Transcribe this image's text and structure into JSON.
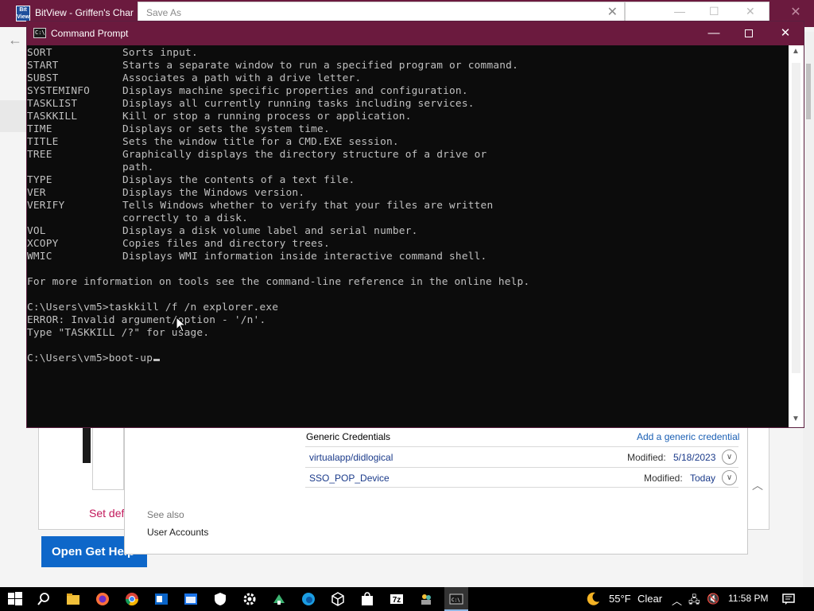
{
  "browser": {
    "title": "BitView - Griffen's Char",
    "app_icon_text": "Bit View"
  },
  "save_as": {
    "title": "Save As"
  },
  "cmd": {
    "title": "Command Prompt",
    "help_rows": [
      {
        "cmd": "SORT",
        "desc": "Sorts input."
      },
      {
        "cmd": "START",
        "desc": "Starts a separate window to run a specified program or command."
      },
      {
        "cmd": "SUBST",
        "desc": "Associates a path with a drive letter."
      },
      {
        "cmd": "SYSTEMINFO",
        "desc": "Displays machine specific properties and configuration."
      },
      {
        "cmd": "TASKLIST",
        "desc": "Displays all currently running tasks including services."
      },
      {
        "cmd": "TASKKILL",
        "desc": "Kill or stop a running process or application."
      },
      {
        "cmd": "TIME",
        "desc": "Displays or sets the system time."
      },
      {
        "cmd": "TITLE",
        "desc": "Sets the window title for a CMD.EXE session."
      },
      {
        "cmd": "TREE",
        "desc": "Graphically displays the directory structure of a drive or"
      },
      {
        "cmd": "",
        "desc": "path."
      },
      {
        "cmd": "TYPE",
        "desc": "Displays the contents of a text file."
      },
      {
        "cmd": "VER",
        "desc": "Displays the Windows version."
      },
      {
        "cmd": "VERIFY",
        "desc": "Tells Windows whether to verify that your files are written"
      },
      {
        "cmd": "",
        "desc": "correctly to a disk."
      },
      {
        "cmd": "VOL",
        "desc": "Displays a disk volume label and serial number."
      },
      {
        "cmd": "XCOPY",
        "desc": "Copies files and directory trees."
      },
      {
        "cmd": "WMIC",
        "desc": "Displays WMI information inside interactive command shell."
      }
    ],
    "more_info": "For more information on tools see the command-line reference in the online help.",
    "history": [
      "C:\\Users\\vm5>taskkill /f /n explorer.exe",
      "ERROR: Invalid argument/option - '/n'.",
      "Type \"TASKKILL /?\" for usage."
    ],
    "prompt": "C:\\Users\\vm5>",
    "current_input": "boot-up"
  },
  "credentials": {
    "header": "Generic Credentials",
    "add_link": "Add a generic credential",
    "items": [
      {
        "name": "virtualapp/didlogical",
        "modified_label": "Modified:",
        "modified_value": "5/18/2023"
      },
      {
        "name": "SSO_POP_Device",
        "modified_label": "Modified:",
        "modified_value": "Today"
      }
    ],
    "see_also": "See also",
    "user_accounts": "User Accounts"
  },
  "background_page": {
    "set_default_fragment": "Set def",
    "open_button_fragment": "Open Get Help"
  },
  "taskbar": {
    "weather_temp": "55°F",
    "weather_condition": "Clear",
    "time": "11:58 PM",
    "icons": [
      "windows-start-icon",
      "search-icon",
      "file-explorer-icon",
      "firefox-icon",
      "chrome-icon",
      "outlook-icon",
      "calendar-icon",
      "shield-icon",
      "settings-icon",
      "app-icon",
      "edge-icon",
      "box-icon",
      "store-icon",
      "7zip-icon",
      "people-icon",
      "command-prompt-icon"
    ]
  },
  "colors": {
    "titlebar": "#6b1a3e",
    "console_bg": "#0c0c0c",
    "console_text": "#c0c0c0",
    "link_blue": "#1a5fb4",
    "button_blue": "#0e67c9"
  }
}
